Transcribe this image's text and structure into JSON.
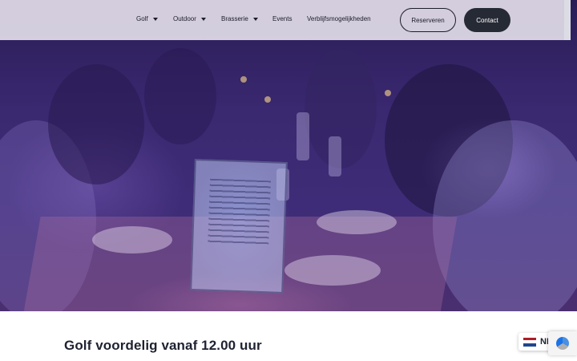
{
  "nav": {
    "items": [
      {
        "label": "Golf",
        "dropdown": true
      },
      {
        "label": "Outdoor",
        "dropdown": true
      },
      {
        "label": "Brasserie",
        "dropdown": true
      },
      {
        "label": "Events",
        "dropdown": false
      },
      {
        "label": "Verblijfsmogelijkheden",
        "dropdown": false
      }
    ],
    "reserve_label": "Reserveren",
    "contact_label": "Contact"
  },
  "hero": {
    "image_subject": "dinner-party-photo"
  },
  "content": {
    "headline": "Golf voordelig vanaf 12.00 uur"
  },
  "language": {
    "code": "NL",
    "flag": "netherlands-flag-icon"
  },
  "colors": {
    "nav_background": "#ebe6f0",
    "contact_button": "#262a35",
    "headline": "#1f2230",
    "hero_tint": "#3a2870"
  }
}
